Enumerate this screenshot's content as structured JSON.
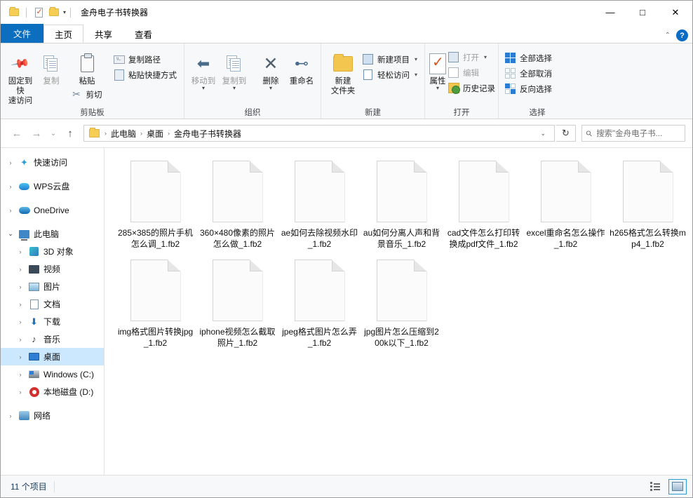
{
  "window": {
    "title": "金舟电子书转换器",
    "quick_access": [
      "folder-icon",
      "properties-icon",
      "folder-icon",
      "chevron-down-icon"
    ],
    "controls": {
      "minimize": "—",
      "maximize": "□",
      "close": "✕"
    },
    "help": "?"
  },
  "tabs": [
    {
      "id": "file",
      "label": "文件"
    },
    {
      "id": "home",
      "label": "主页"
    },
    {
      "id": "share",
      "label": "共享"
    },
    {
      "id": "view",
      "label": "查看"
    }
  ],
  "ribbon": {
    "groups": [
      {
        "name": "剪贴板",
        "big": [
          {
            "label": "固定到快\n速访问",
            "label_l1": "固定到快",
            "label_l2": "速访问",
            "icon": "pin-icon",
            "dim": false
          },
          {
            "label": "复制",
            "icon": "copy-icon",
            "dim": true
          },
          {
            "label": "粘贴",
            "icon": "paste-icon",
            "dim": false
          }
        ],
        "small": [
          {
            "label": "复制路径",
            "icon": "copy-path-icon"
          },
          {
            "label": "粘贴快捷方式",
            "icon": "paste-shortcut-icon"
          }
        ],
        "extra": [
          {
            "label": "剪切",
            "icon": "scissors-icon"
          }
        ]
      },
      {
        "name": "组织",
        "big": [
          {
            "label": "移动到",
            "icon": "move-to-icon",
            "dim": true
          },
          {
            "label": "复制到",
            "icon": "copy-to-icon",
            "dim": true
          },
          {
            "label": "删除",
            "icon": "delete-icon",
            "dim": false
          },
          {
            "label": "重命名",
            "icon": "rename-icon",
            "dim": false
          }
        ]
      },
      {
        "name": "新建",
        "big": [
          {
            "label_l1": "新建",
            "label_l2": "文件夹",
            "icon": "new-folder-icon",
            "dim": false
          }
        ],
        "small": [
          {
            "label": "新建项目",
            "icon": "new-item-icon",
            "caret": "▾"
          },
          {
            "label": "轻松访问",
            "icon": "easy-access-icon",
            "caret": "▾"
          }
        ]
      },
      {
        "name": "打开",
        "big": [
          {
            "label": "属性",
            "icon": "properties-icon",
            "dim": false,
            "caret": "▾"
          }
        ],
        "small": [
          {
            "label": "打开",
            "icon": "open-icon",
            "caret": "▾",
            "dim": true
          },
          {
            "label": "编辑",
            "icon": "edit-icon",
            "dim": true
          },
          {
            "label": "历史记录",
            "icon": "history-icon",
            "dim": false
          }
        ]
      },
      {
        "name": "选择",
        "small": [
          {
            "label": "全部选择",
            "icon": "select-all-icon"
          },
          {
            "label": "全部取消",
            "icon": "select-none-icon"
          },
          {
            "label": "反向选择",
            "icon": "invert-selection-icon"
          }
        ]
      }
    ]
  },
  "addressbar": {
    "back": "←",
    "forward": "→",
    "recent": "⌄",
    "up": "↑",
    "crumbs": [
      "此电脑",
      "桌面",
      "金舟电子书转换器"
    ],
    "crumb_caret": "⌄",
    "refresh": "↻",
    "search_placeholder": "搜索\"金舟电子书..."
  },
  "sidebar": {
    "items": [
      {
        "label": "快速访问",
        "icon": "star-icon",
        "level": 1,
        "expander": "›",
        "selected": false
      },
      {
        "label": "WPS云盘",
        "icon": "wps-cloud-icon",
        "level": 1,
        "expander": "›",
        "selected": false
      },
      {
        "label": "OneDrive",
        "icon": "onedrive-icon",
        "level": 1,
        "expander": "›",
        "selected": false
      },
      {
        "label": "此电脑",
        "icon": "this-pc-icon",
        "level": 1,
        "expander": "⌄",
        "selected": false
      },
      {
        "label": "3D 对象",
        "icon": "3d-objects-icon",
        "level": 2,
        "expander": "›",
        "selected": false
      },
      {
        "label": "视频",
        "icon": "videos-icon",
        "level": 2,
        "expander": "›",
        "selected": false
      },
      {
        "label": "图片",
        "icon": "pictures-icon",
        "level": 2,
        "expander": "›",
        "selected": false
      },
      {
        "label": "文档",
        "icon": "documents-icon",
        "level": 2,
        "expander": "›",
        "selected": false
      },
      {
        "label": "下载",
        "icon": "downloads-icon",
        "level": 2,
        "expander": "›",
        "selected": false
      },
      {
        "label": "音乐",
        "icon": "music-icon",
        "level": 2,
        "expander": "›",
        "selected": false
      },
      {
        "label": "桌面",
        "icon": "desktop-icon",
        "level": 2,
        "expander": "›",
        "selected": true
      },
      {
        "label": "Windows (C:)",
        "icon": "c-drive-icon",
        "level": 2,
        "expander": "›",
        "selected": false
      },
      {
        "label": "本地磁盘 (D:)",
        "icon": "d-drive-icon",
        "level": 2,
        "expander": "›",
        "selected": false
      },
      {
        "label": "网络",
        "icon": "network-icon",
        "level": 1,
        "expander": "›",
        "selected": false
      }
    ]
  },
  "files": [
    {
      "name": "285×385的照片手机怎么调_1.fb2",
      "icon": "generic-file-icon"
    },
    {
      "name": "360×480像素的照片怎么做_1.fb2",
      "icon": "generic-file-icon"
    },
    {
      "name": "ae如何去除视频水印_1.fb2",
      "icon": "generic-file-icon"
    },
    {
      "name": "au如何分离人声和背景音乐_1.fb2",
      "icon": "generic-file-icon"
    },
    {
      "name": "cad文件怎么打印转换成pdf文件_1.fb2",
      "icon": "generic-file-icon"
    },
    {
      "name": "excel重命名怎么操作_1.fb2",
      "icon": "generic-file-icon"
    },
    {
      "name": "h265格式怎么转换mp4_1.fb2",
      "icon": "generic-file-icon"
    },
    {
      "name": "img格式图片转换jpg_1.fb2",
      "icon": "generic-file-icon"
    },
    {
      "name": "iphone视频怎么截取照片_1.fb2",
      "icon": "generic-file-icon"
    },
    {
      "name": "jpeg格式图片怎么弄_1.fb2",
      "icon": "generic-file-icon"
    },
    {
      "name": "jpg图片怎么压缩到200k以下_1.fb2",
      "icon": "generic-file-icon"
    }
  ],
  "statusbar": {
    "item_count": "11 个项目",
    "views": [
      {
        "name": "details-view",
        "active": false
      },
      {
        "name": "large-icons-view",
        "active": true
      }
    ]
  },
  "colors": {
    "accent": "#0b6ebe",
    "selection": "#cce8ff",
    "ribbon_bg": "#f7f8f9",
    "folder_yellow": "#f7ce54"
  }
}
